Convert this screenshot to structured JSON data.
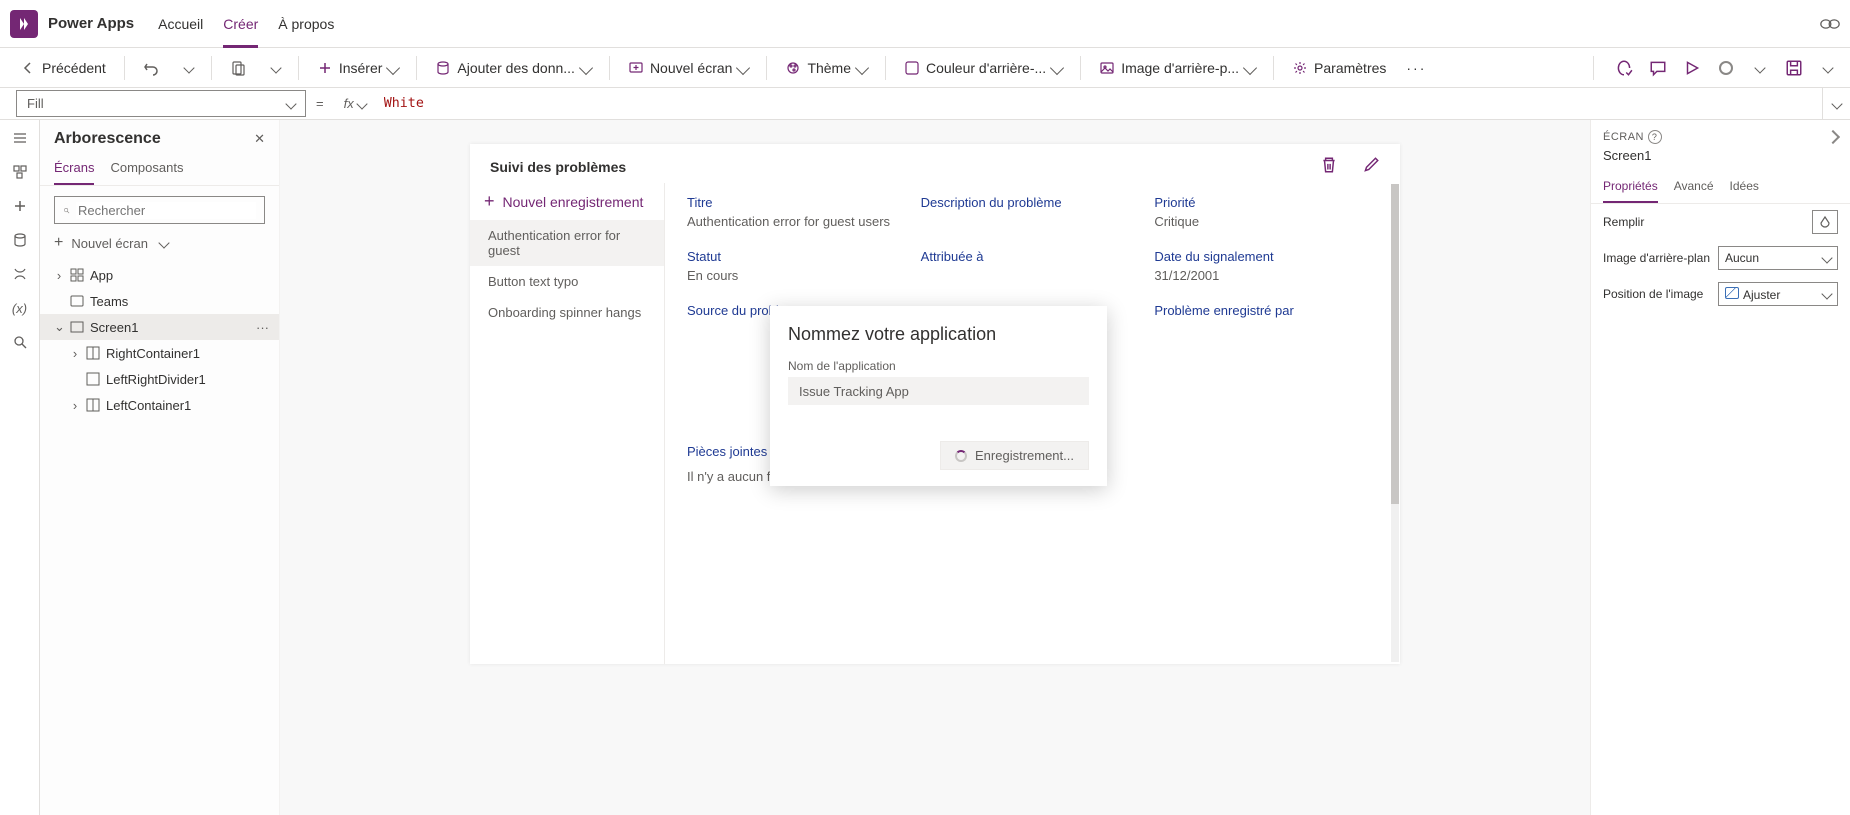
{
  "header": {
    "app_title": "Power Apps",
    "nav": {
      "accueil": "Accueil",
      "creer": "Créer",
      "apropos": "À propos"
    }
  },
  "cmdbar": {
    "back": "Précédent",
    "insert": "Insérer",
    "add_data": "Ajouter des donn...",
    "new_screen": "Nouvel écran",
    "theme": "Thème",
    "bg_color": "Couleur d'arrière-...",
    "bg_image": "Image d'arrière-p...",
    "settings": "Paramètres"
  },
  "formula": {
    "property": "Fill",
    "fx": "fx",
    "value": "White"
  },
  "tree": {
    "title": "Arborescence",
    "tabs": {
      "screens": "Écrans",
      "components": "Composants"
    },
    "search_placeholder": "Rechercher",
    "new_screen": "Nouvel écran",
    "nodes": {
      "app": "App",
      "teams": "Teams",
      "screen1": "Screen1",
      "right": "RightContainer1",
      "divider": "LeftRightDivider1",
      "left": "LeftContainer1"
    }
  },
  "canvas": {
    "title": "Suivi des problèmes",
    "new_record": "Nouvel enregistrement",
    "list": {
      "i0": "Authentication error for guest",
      "i1": "Button text typo",
      "i2": "Onboarding spinner hangs"
    },
    "labels": {
      "titre": "Titre",
      "desc": "Description du problème",
      "priorite": "Priorité",
      "statut": "Statut",
      "assignee": "Attribuée à",
      "date": "Date du signalement",
      "source": "Source du probl",
      "logged_by": "Problème enregistré par",
      "attachments": "Pièces jointes"
    },
    "values": {
      "titre": "Authentication error for guest users",
      "priorite": "Critique",
      "statut": "En cours",
      "date": "31/12/2001",
      "no_attach": "Il n'y a aucun fichier joint."
    }
  },
  "modal": {
    "title": "Nommez votre application",
    "label": "Nom de l'application",
    "value": "Issue Tracking App",
    "saving": "Enregistrement..."
  },
  "props": {
    "section": "ÉCRAN",
    "screen": "Screen1",
    "tabs": {
      "props": "Propriétés",
      "advanced": "Avancé",
      "ideas": "Idées"
    },
    "fill": "Remplir",
    "bgimage": "Image d'arrière-plan",
    "bgimage_val": "Aucun",
    "imgpos": "Position de l'image",
    "imgpos_val": "Ajuster"
  }
}
